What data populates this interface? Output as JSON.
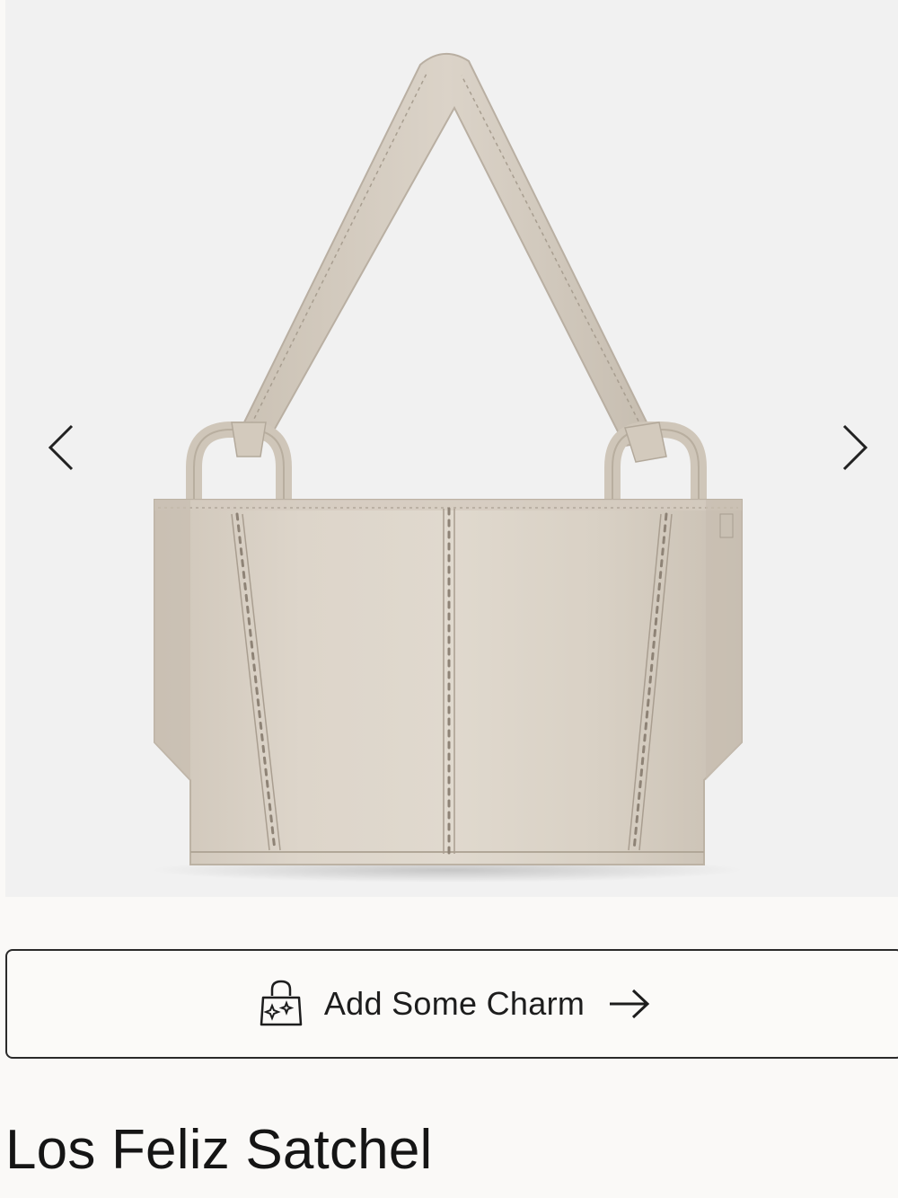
{
  "gallery": {
    "image_alt": "Los Feliz Satchel",
    "prev_icon": "chevron-left-icon",
    "next_icon": "chevron-right-icon"
  },
  "charm_button": {
    "label": "Add Some Charm",
    "icon": "shopping-bag-sparkle-icon",
    "arrow_icon": "arrow-right-icon"
  },
  "product": {
    "title": "Los Feliz Satchel"
  },
  "colors": {
    "page_background": "#faf9f7",
    "image_background": "#f1f1f1",
    "bag_leather": "#d8d0c4",
    "stitching": "#8e8376",
    "button_border": "#2a2a2a"
  }
}
